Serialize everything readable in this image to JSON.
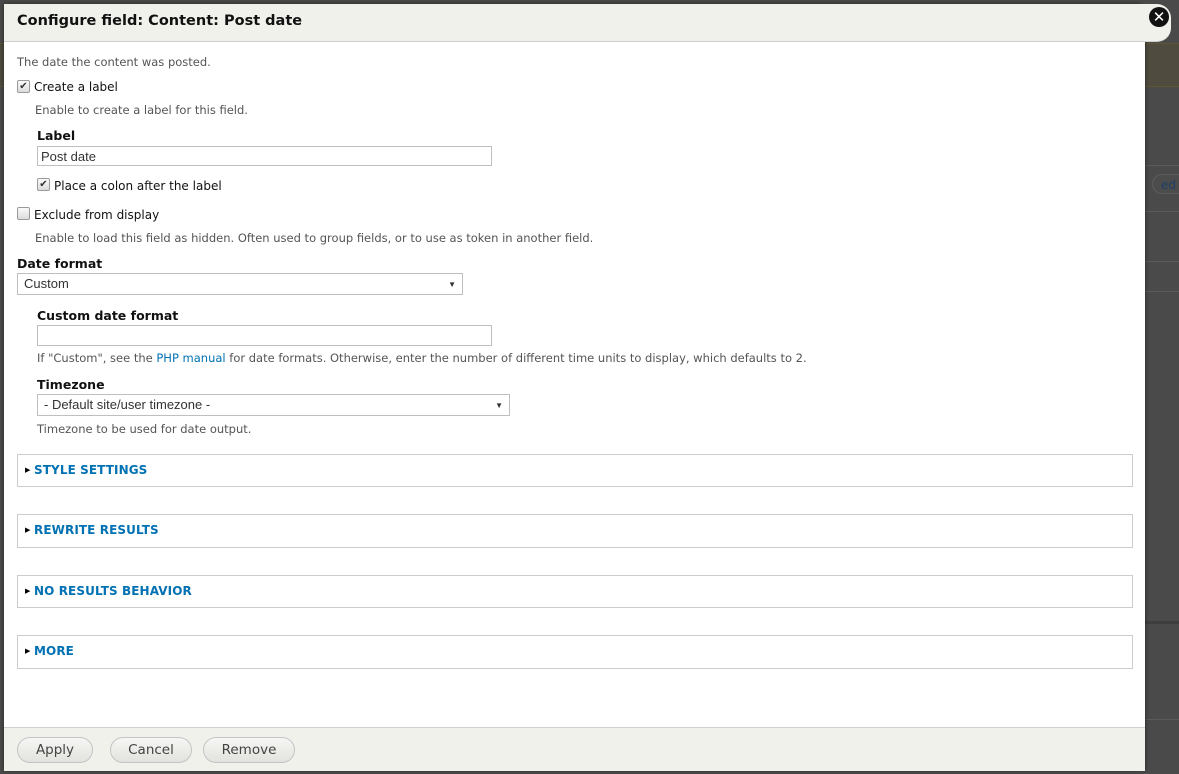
{
  "background": {
    "edit_button_partial": "ed"
  },
  "dialog": {
    "title": "Configure field: Content: Post date",
    "close_icon": "close-icon",
    "description": "The date the content was posted.",
    "create_label": {
      "label": "Create a label",
      "checked": true,
      "help": "Enable to create a label for this field."
    },
    "label_field": {
      "label": "Label",
      "value": "Post date"
    },
    "place_colon": {
      "label": "Place a colon after the label",
      "checked": true
    },
    "exclude": {
      "label": "Exclude from display",
      "checked": false,
      "help": "Enable to load this field as hidden. Often used to group fields, or to use as token in another field."
    },
    "date_format": {
      "label": "Date format",
      "selected": "Custom"
    },
    "custom_date_format": {
      "label": "Custom date format",
      "value": "",
      "help_prefix": "If \"Custom\", see the ",
      "help_link": "PHP manual",
      "help_suffix": " for date formats. Otherwise, enter the number of different time units to display, which defaults to 2."
    },
    "timezone": {
      "label": "Timezone",
      "selected": "- Default site/user timezone -",
      "help": "Timezone to be used for date output."
    },
    "sections": [
      {
        "label": "STYLE SETTINGS"
      },
      {
        "label": "REWRITE RESULTS"
      },
      {
        "label": "NO RESULTS BEHAVIOR"
      },
      {
        "label": "MORE"
      }
    ],
    "buttons": {
      "apply": "Apply",
      "cancel": "Cancel",
      "remove": "Remove"
    },
    "colors": {
      "link": "#0071b3",
      "titlebar_bg": "#f1f1ec",
      "overlay": "#4a4a4a"
    }
  }
}
